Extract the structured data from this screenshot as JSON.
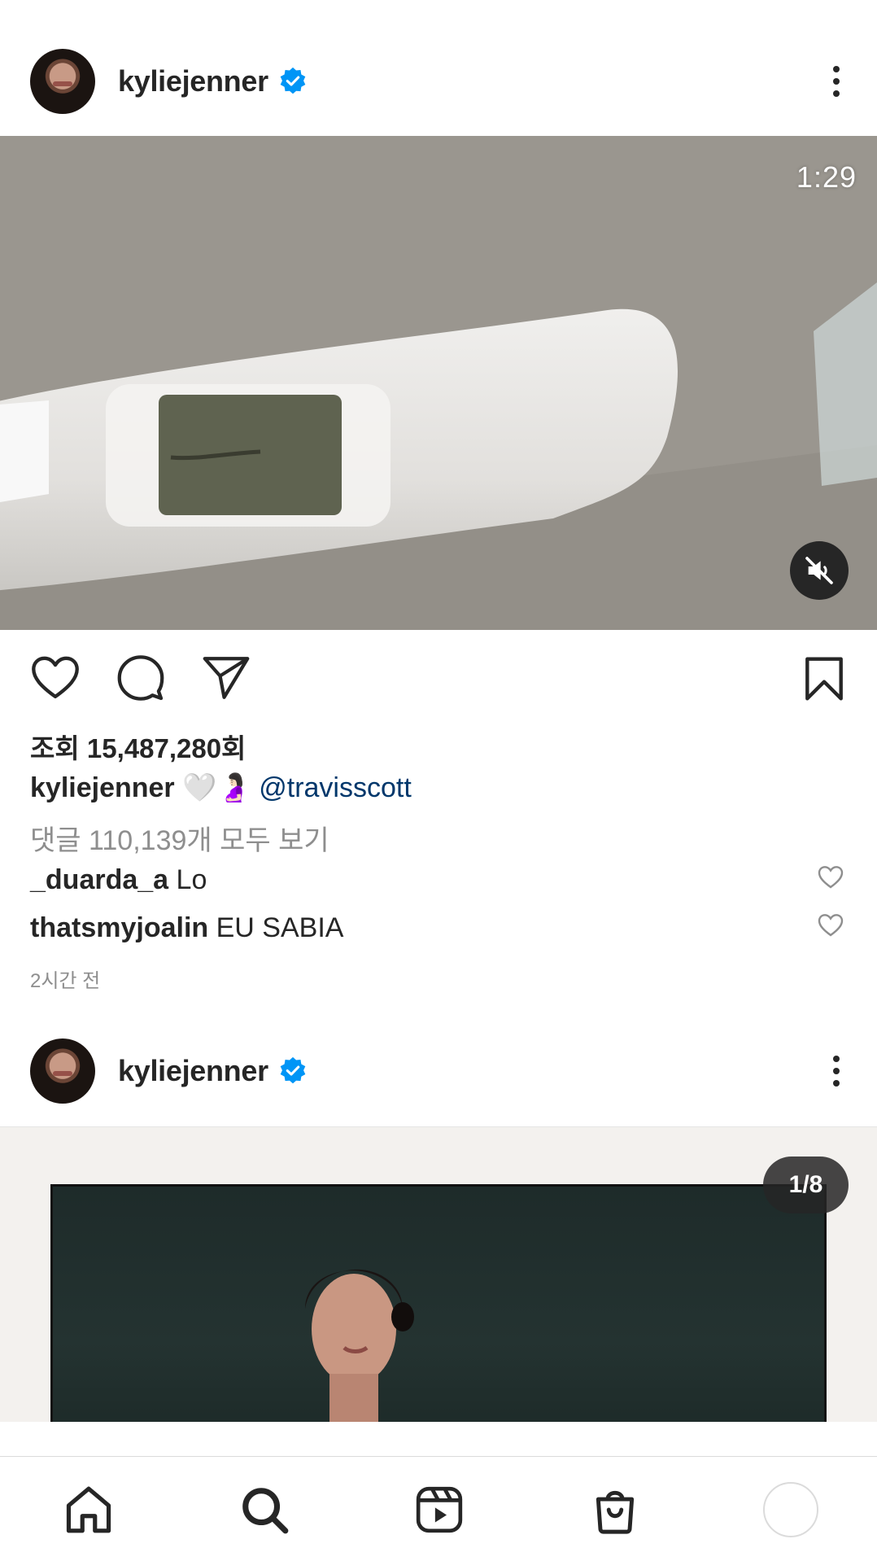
{
  "posts": [
    {
      "username": "kyliejenner",
      "media": {
        "duration": "1:29"
      },
      "views_text": "조회 15,487,280회",
      "caption": {
        "username": "kyliejenner",
        "text": "🤍🤰🏻 ",
        "mention": "@travisscott"
      },
      "view_comments": "댓글 110,139개 모두 보기",
      "comments": [
        {
          "username": "_duarda_a",
          "text": "Lo"
        },
        {
          "username": "thatsmyjoalin",
          "text": "EU SABIA"
        }
      ],
      "timestamp": "2시간 전"
    },
    {
      "username": "kyliejenner",
      "media": {
        "pagination": "1/8"
      }
    }
  ],
  "nav": {
    "items": [
      "home-icon",
      "search-icon",
      "reels-icon",
      "shop-icon",
      "profile-avatar"
    ]
  },
  "colors": {
    "verified": "#0095f6",
    "mention": "#00376b",
    "secondary_text": "#8e8e8e"
  }
}
